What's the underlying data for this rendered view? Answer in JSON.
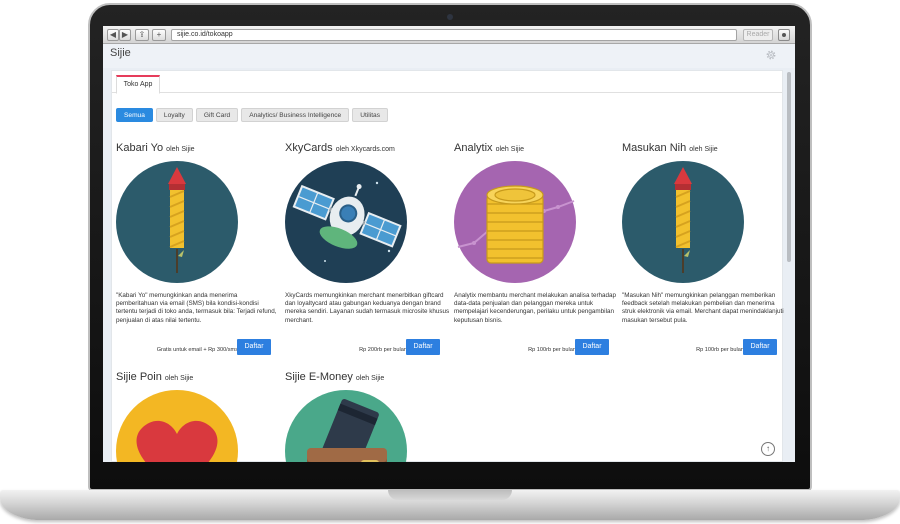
{
  "browser": {
    "url": "sijie.co.id/tokoapp",
    "reader_label": "Reader",
    "back_glyph": "◀",
    "forward_glyph": "▶",
    "share_glyph": "⇪",
    "add_glyph": "+"
  },
  "app": {
    "brand": "Sijie",
    "tab": "Toko App",
    "filters": [
      "Semua",
      "Loyalty",
      "Gift Card",
      "Analytics/ Business Intelligence",
      "Utilitas"
    ],
    "active_filter": "Semua",
    "accent_color": "#2d7fe0",
    "tab_accent_color": "#e63c5b"
  },
  "cards": [
    {
      "name": "Kabari Yo",
      "by": "oleh Sijie",
      "icon": "firework-rocket-icon",
      "description": "\"Kabari Yo\" memungkinkan anda menerima pemberitahuan via email (SMS) bila kondisi-kondisi tertentu terjadi di toko anda, termasuk bila: Terjadi refund, penjualan di atas nilai tertentu.",
      "price": "Gratis untuk email + Rp 300/sms",
      "button": "Daftar"
    },
    {
      "name": "XkyCards",
      "by": "oleh Xkycards.com",
      "icon": "satellite-icon",
      "description": "XkyCards memungkinkan merchant menerbitkan giftcard dan loyaltycard atau gabungan keduanya dengan brand mereka sendiri. Layanan sudah termasuk microsite khusus merchant.",
      "price": "Rp 200rb per bulan",
      "button": "Daftar"
    },
    {
      "name": "Analytix",
      "by": "oleh Sijie",
      "icon": "coin-stack-icon",
      "description": "Analytix membantu merchant melakukan analisa terhadap data-data penjualan dan pelanggan mereka untuk mempelajari kecenderungan, perilaku untuk pengambilan keputusan bisnis.",
      "price": "Rp 100rb per bulan",
      "button": "Daftar"
    },
    {
      "name": "Masukan Nih",
      "by": "oleh Sijie",
      "icon": "firework-rocket-icon",
      "description": "\"Masukan Nih\" memungkinkan pelanggan memberikan feedback setelah melakukan pembelian dan menerima struk elektronik via email. Merchant dapat menindaklanjuti masukan tersebut pula.",
      "price": "Rp 100rb per bulan",
      "button": "Daftar"
    },
    {
      "name": "Sijie Poin",
      "by": "oleh Sijie",
      "icon": "heart-icon"
    },
    {
      "name": "Sijie E-Money",
      "by": "oleh Sijie",
      "icon": "wallet-icon"
    }
  ]
}
